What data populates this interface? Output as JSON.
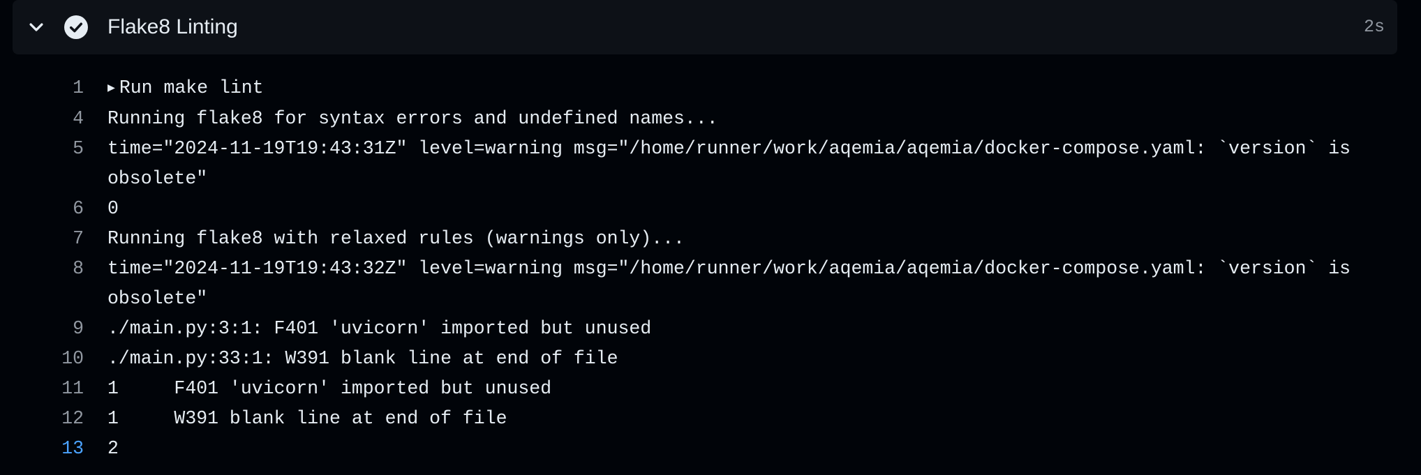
{
  "step": {
    "title": "Flake8 Linting",
    "duration": "2s",
    "status": "success",
    "icons": {
      "toggle": "chevron-down-icon",
      "status": "check-circle-icon"
    }
  },
  "colors": {
    "background": "#010409",
    "header_bg": "#0d1117",
    "text": "#e6edf3",
    "muted": "#9198a1",
    "active_line": "#4ba3ff"
  },
  "log": {
    "group": {
      "num": "1",
      "triangle": "▶",
      "text": "Run make lint"
    },
    "lines": [
      {
        "num": "4",
        "text": "Running flake8 for syntax errors and undefined names..."
      },
      {
        "num": "5",
        "text": "time=\"2024-11-19T19:43:31Z\" level=warning msg=\"/home/runner/work/aqemia/aqemia/docker-compose.yaml: `version` is obsolete\""
      },
      {
        "num": "6",
        "text": "0"
      },
      {
        "num": "7",
        "text": "Running flake8 with relaxed rules (warnings only)..."
      },
      {
        "num": "8",
        "text": "time=\"2024-11-19T19:43:32Z\" level=warning msg=\"/home/runner/work/aqemia/aqemia/docker-compose.yaml: `version` is obsolete\""
      },
      {
        "num": "9",
        "text": "./main.py:3:1: F401 'uvicorn' imported but unused"
      },
      {
        "num": "10",
        "text": "./main.py:33:1: W391 blank line at end of file"
      },
      {
        "num": "11",
        "text": "1     F401 'uvicorn' imported but unused"
      },
      {
        "num": "12",
        "text": "1     W391 blank line at end of file"
      },
      {
        "num": "13",
        "text": "2"
      }
    ]
  }
}
